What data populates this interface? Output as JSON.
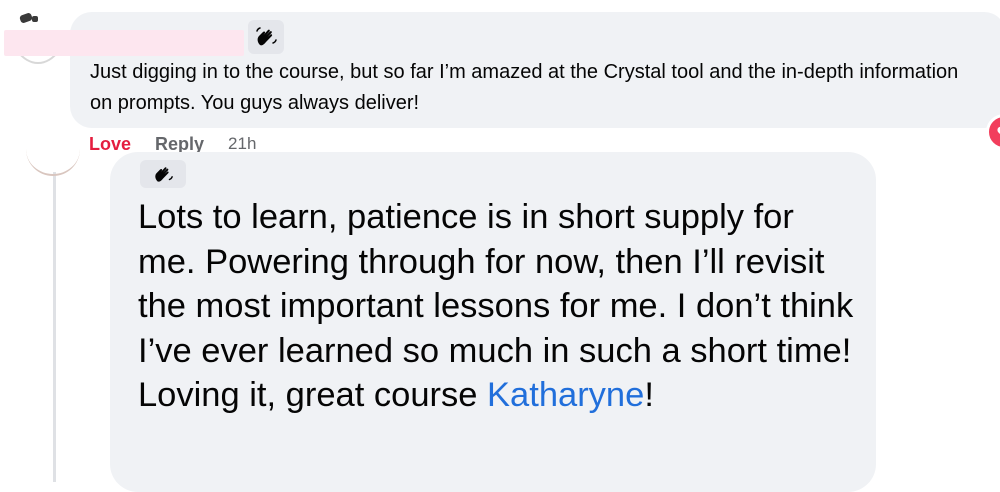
{
  "comment1": {
    "author_badge_icon": "waving-hand-icon",
    "text": "Just digging in to the course, but so far I’m amazed at the Crystal tool and the in-depth information on prompts. You guys always deliver!",
    "reaction_icon": "heart-icon",
    "reaction_color": "#f23e5c"
  },
  "actions": {
    "love_label": "Love",
    "reply_label": "Reply",
    "timestamp": "21h",
    "love_color": "#e41e3f"
  },
  "comment2": {
    "author_badge_icon": "waving-hand-icon",
    "text": "Lots to learn, patience is in short supply for me. Powering through for now, then I’ll revisit the most important lessons for me. I don’t think I’ve ever learned so much in such a short time! Loving it, great course ",
    "mention": "Katharyne",
    "suffix": "!",
    "mention_color": "#216fdb"
  },
  "colors": {
    "bubble_bg": "#f0f2f5",
    "text": "#050505",
    "muted": "#65676b"
  }
}
